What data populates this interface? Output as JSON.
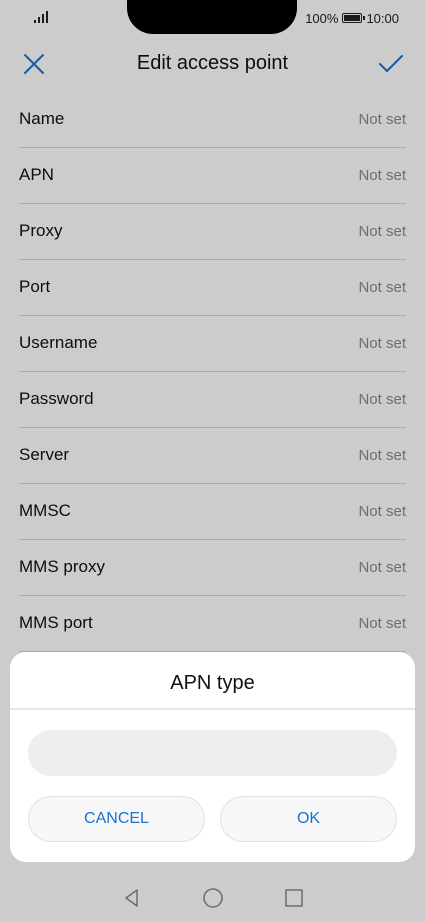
{
  "status": {
    "battery_percent": "100%",
    "time": "10:00"
  },
  "header": {
    "title": "Edit access point",
    "close_icon": "close-icon",
    "confirm_icon": "checkmark-icon"
  },
  "rows": [
    {
      "label": "Name",
      "value": "Not set"
    },
    {
      "label": "APN",
      "value": "Not set"
    },
    {
      "label": "Proxy",
      "value": "Not set"
    },
    {
      "label": "Port",
      "value": "Not set"
    },
    {
      "label": "Username",
      "value": "Not set"
    },
    {
      "label": "Password",
      "value": "Not set"
    },
    {
      "label": "Server",
      "value": "Not set"
    },
    {
      "label": "MMSC",
      "value": "Not set"
    },
    {
      "label": "MMS proxy",
      "value": "Not set"
    },
    {
      "label": "MMS port",
      "value": "Not set"
    },
    {
      "label": "",
      "value": ""
    }
  ],
  "dialog": {
    "title": "APN type",
    "input_value": "",
    "cancel_label": "CANCEL",
    "ok_label": "OK"
  },
  "colors": {
    "accent": "#1a73d0",
    "overlay": "rgba(0,0,0,0.2)"
  }
}
